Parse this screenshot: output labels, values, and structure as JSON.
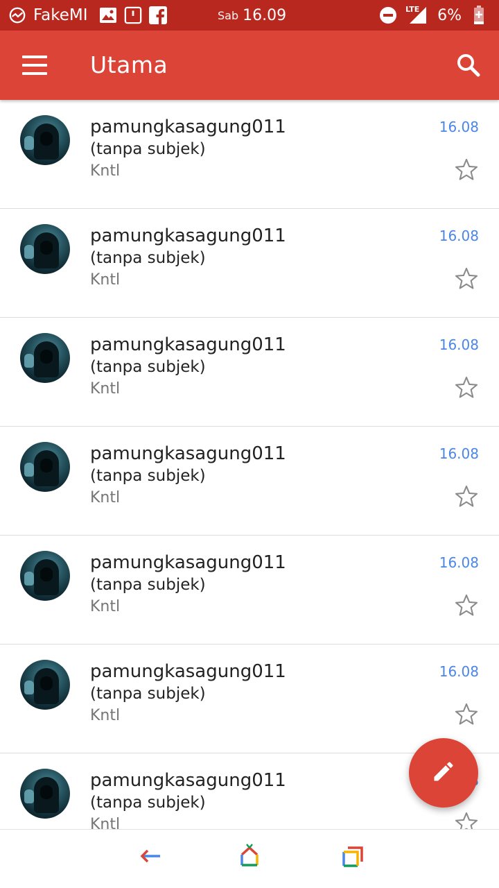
{
  "status_bar": {
    "carrier": "FakeMI",
    "day": "Sab",
    "time": "16.09",
    "network": "LTE",
    "battery": "6%",
    "icons": [
      "vpn-icon",
      "gallery-icon",
      "notification-icon",
      "facebook-icon",
      "dnd-icon",
      "signal-icon",
      "battery-icon"
    ]
  },
  "app_bar": {
    "title": "Utama",
    "menu_icon": "hamburger-menu-icon",
    "search_icon": "search-icon"
  },
  "mails": [
    {
      "sender": "pamungkasagung011",
      "subject": "(tanpa subjek)",
      "snippet": "Kntl",
      "time": "16.08"
    },
    {
      "sender": "pamungkasagung011",
      "subject": "(tanpa subjek)",
      "snippet": "Kntl",
      "time": "16.08"
    },
    {
      "sender": "pamungkasagung011",
      "subject": "(tanpa subjek)",
      "snippet": "Kntl",
      "time": "16.08"
    },
    {
      "sender": "pamungkasagung011",
      "subject": "(tanpa subjek)",
      "snippet": "Kntl",
      "time": "16.08"
    },
    {
      "sender": "pamungkasagung011",
      "subject": "(tanpa subjek)",
      "snippet": "Kntl",
      "time": "16.08"
    },
    {
      "sender": "pamungkasagung011",
      "subject": "(tanpa subjek)",
      "snippet": "Kntl",
      "time": "16.08"
    },
    {
      "sender": "pamungkasagung011",
      "subject": "(tanpa subjek)",
      "snippet": "Kntl",
      "time": "16.08"
    }
  ],
  "fab": {
    "icon": "pencil-compose-icon"
  },
  "nav_bar": {
    "icons": [
      "back-icon",
      "home-icon",
      "recents-icon"
    ]
  },
  "colors": {
    "status_bar": "#b8281f",
    "app_bar": "#db4437",
    "time_accent": "#4a86e8",
    "snippet_gray": "#757575"
  }
}
